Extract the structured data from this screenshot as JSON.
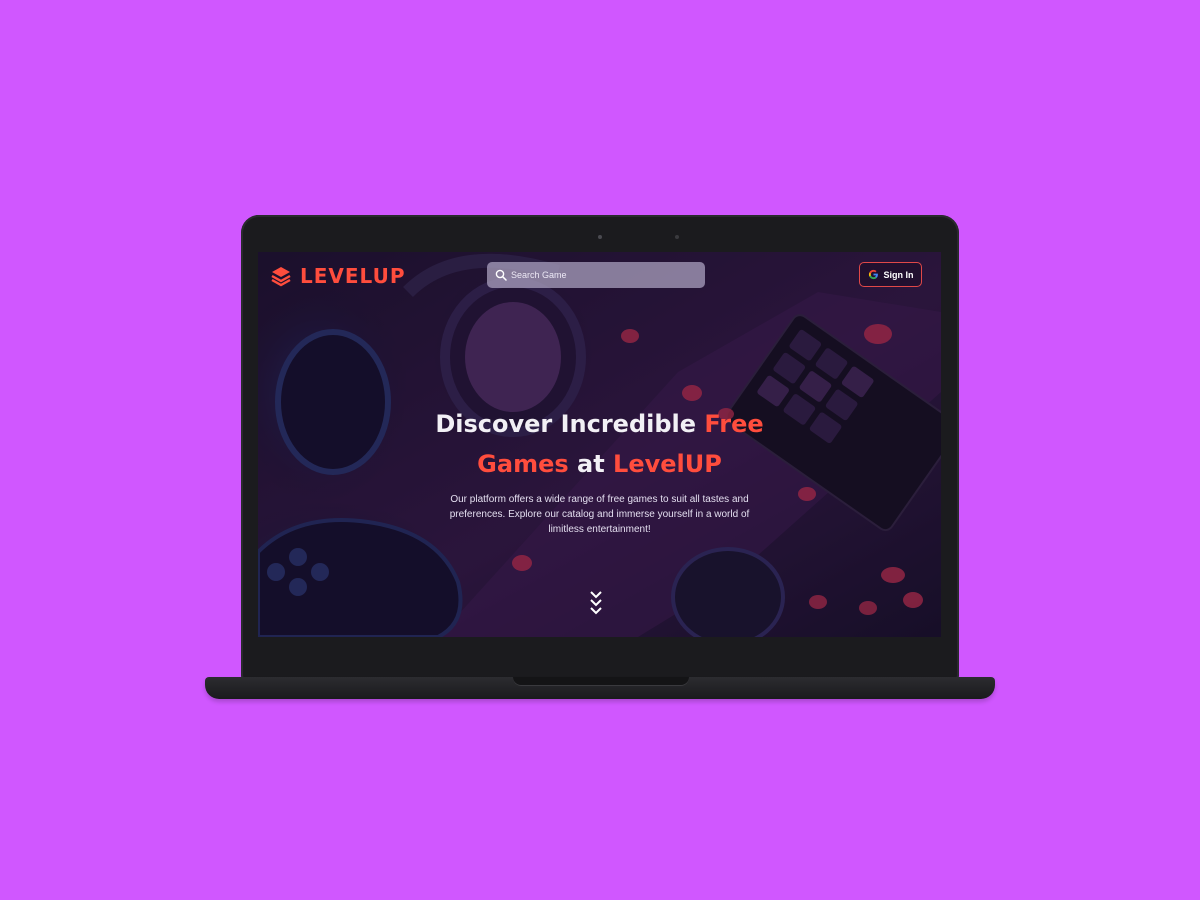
{
  "colors": {
    "page_background": "#d057ff",
    "brand_accent": "#ff4d3d",
    "signin_border": "#e04848"
  },
  "header": {
    "brand_name": "LEVELUP",
    "logo_icon": "stacked-layers-icon"
  },
  "search": {
    "placeholder": "Search Game",
    "value": "",
    "icon": "search-icon"
  },
  "auth": {
    "signin_label": "Sign In",
    "icon": "google-icon"
  },
  "hero": {
    "title_part1": "Discover Incredible ",
    "title_accent1": "Free",
    "title_accent2": "Games",
    "title_part2": " at ",
    "title_accent3": "LevelUP",
    "description": "Our platform offers a wide range of free games to suit all tastes and preferences. Explore our catalog and immerse yourself in a world of limitless entertainment!",
    "scroll_icon": "chevrons-down-icon"
  }
}
